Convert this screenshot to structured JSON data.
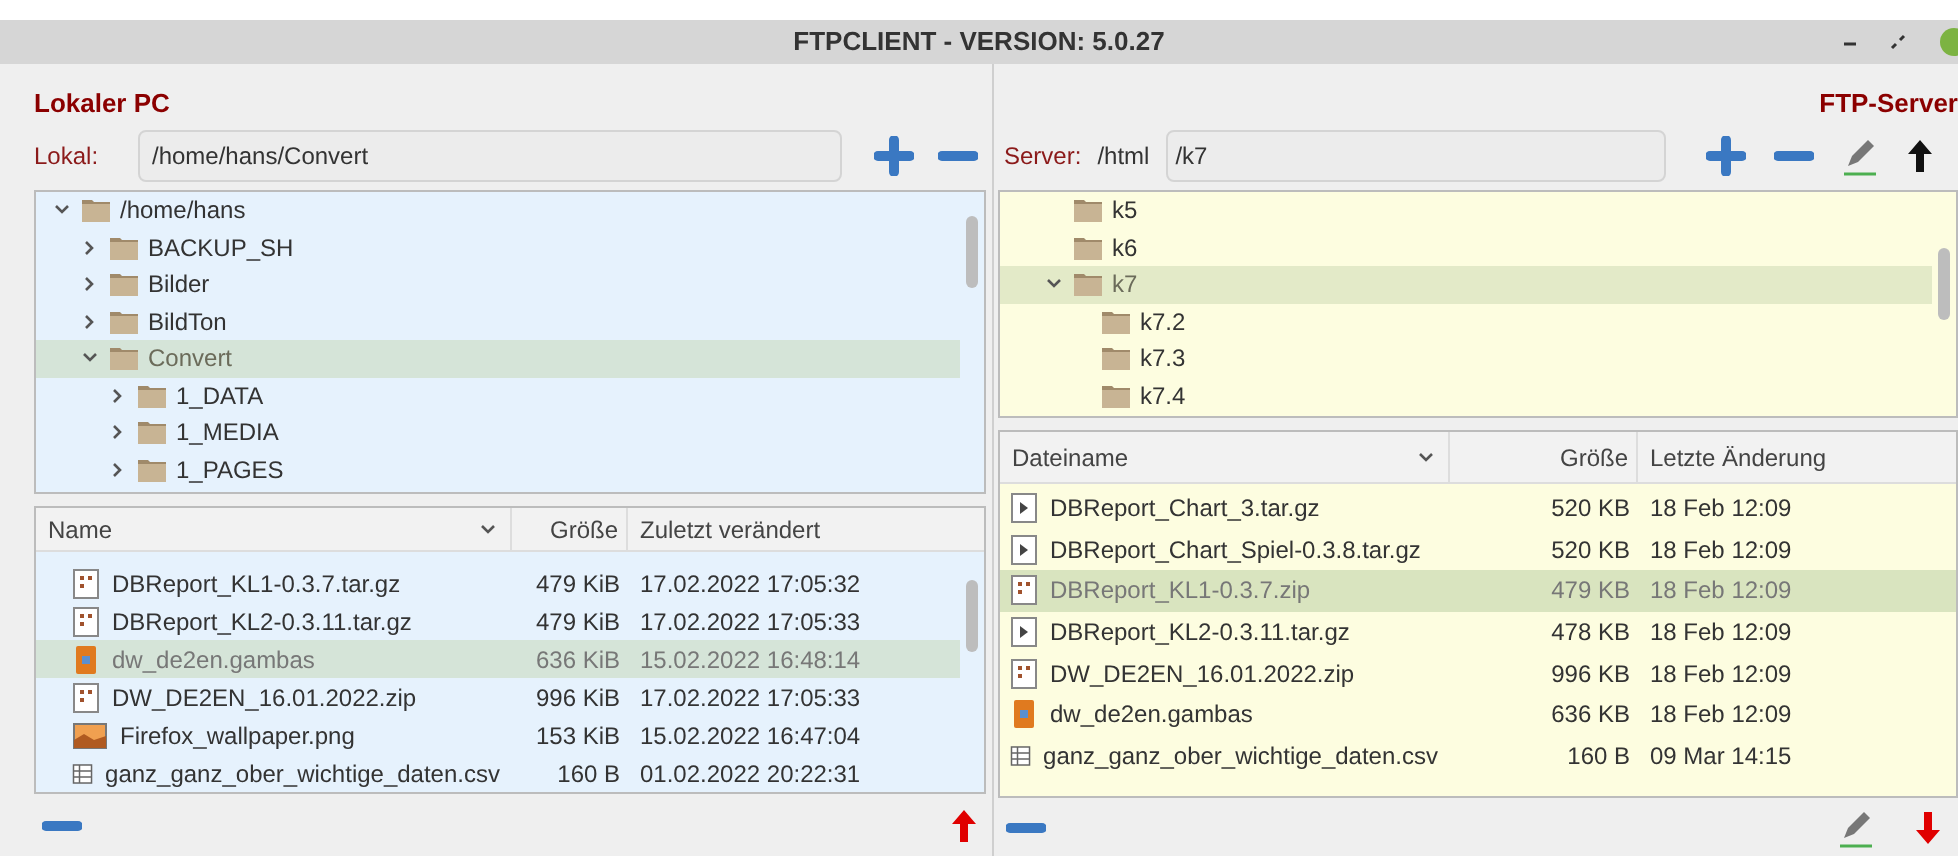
{
  "window": {
    "title": "FTPCLIENT - VERSION: 5.0.27"
  },
  "local": {
    "heading": "Lokaler PC",
    "path_label": "Lokal:",
    "path": "/home/hans/Convert",
    "tree": [
      {
        "name": "/home/hans",
        "expanded": true,
        "selected": false,
        "children": [
          {
            "name": "BACKUP_SH",
            "expanded": false,
            "selected": false
          },
          {
            "name": "Bilder",
            "expanded": false,
            "selected": false
          },
          {
            "name": "BildTon",
            "expanded": false,
            "selected": false
          },
          {
            "name": "Convert",
            "expanded": true,
            "selected": true,
            "children": [
              {
                "name": "1_DATA",
                "expanded": false,
                "selected": false
              },
              {
                "name": "1_MEDIA",
                "expanded": false,
                "selected": false
              },
              {
                "name": "1_PAGES",
                "expanded": false,
                "selected": false
              }
            ]
          }
        ]
      }
    ],
    "columns": [
      "Name",
      "Größe",
      "Zuletzt verändert"
    ],
    "files": [
      {
        "kind": "archive",
        "name": "DBReport_KL1-0.3.7.tar.gz",
        "size": "479 KiB",
        "date": "17.02.2022 17:05:32",
        "selected": false
      },
      {
        "kind": "archive",
        "name": "DBReport_KL2-0.3.11.tar.gz",
        "size": "479 KiB",
        "date": "17.02.2022 17:05:33",
        "selected": false
      },
      {
        "kind": "gambas",
        "name": "dw_de2en.gambas",
        "size": "636 KiB",
        "date": "15.02.2022 16:48:14",
        "selected": true
      },
      {
        "kind": "archive",
        "name": "DW_DE2EN_16.01.2022.zip",
        "size": "996 KiB",
        "date": "17.02.2022 17:05:33",
        "selected": false
      },
      {
        "kind": "image",
        "name": "Firefox_wallpaper.png",
        "size": "153 KiB",
        "date": "15.02.2022 16:47:04",
        "selected": false
      },
      {
        "kind": "table",
        "name": "ganz_ganz_ober_wichtige_daten.csv",
        "size": "160 B",
        "date": "01.02.2022 20:22:31",
        "selected": false
      }
    ]
  },
  "server": {
    "heading": "FTP-Server",
    "path_label": "Server:",
    "root": "/html",
    "path": "/k7",
    "tree": [
      {
        "name": "k5",
        "selected": false
      },
      {
        "name": "k6",
        "selected": false
      },
      {
        "name": "k7",
        "expanded": true,
        "selected": true,
        "children": [
          {
            "name": "k7.2",
            "selected": false
          },
          {
            "name": "k7.3",
            "selected": false
          },
          {
            "name": "k7.4",
            "selected": false
          }
        ]
      }
    ],
    "columns": [
      "Dateiname",
      "Größe",
      "Letzte Änderung"
    ],
    "files": [
      {
        "kind": "package",
        "name": "DBReport_Chart_3.tar.gz",
        "size": "520 KB",
        "date": "18 Feb 12:09",
        "selected": false
      },
      {
        "kind": "package",
        "name": "DBReport_Chart_Spiel-0.3.8.tar.gz",
        "size": "520 KB",
        "date": "18 Feb 12:09",
        "selected": false
      },
      {
        "kind": "archive",
        "name": "DBReport_KL1-0.3.7.zip",
        "size": "479 KB",
        "date": "18 Feb 12:09",
        "selected": true
      },
      {
        "kind": "package",
        "name": "DBReport_KL2-0.3.11.tar.gz",
        "size": "478 KB",
        "date": "18 Feb 12:09",
        "selected": false
      },
      {
        "kind": "archive",
        "name": "DW_DE2EN_16.01.2022.zip",
        "size": "996 KB",
        "date": "18 Feb 12:09",
        "selected": false
      },
      {
        "kind": "gambas",
        "name": "dw_de2en.gambas",
        "size": "636 KB",
        "date": "18 Feb 12:09",
        "selected": false
      },
      {
        "kind": "table",
        "name": "ganz_ganz_ober_wichtige_daten.csv",
        "size": "160 B",
        "date": "09 Mar 14:15",
        "selected": false
      }
    ]
  }
}
